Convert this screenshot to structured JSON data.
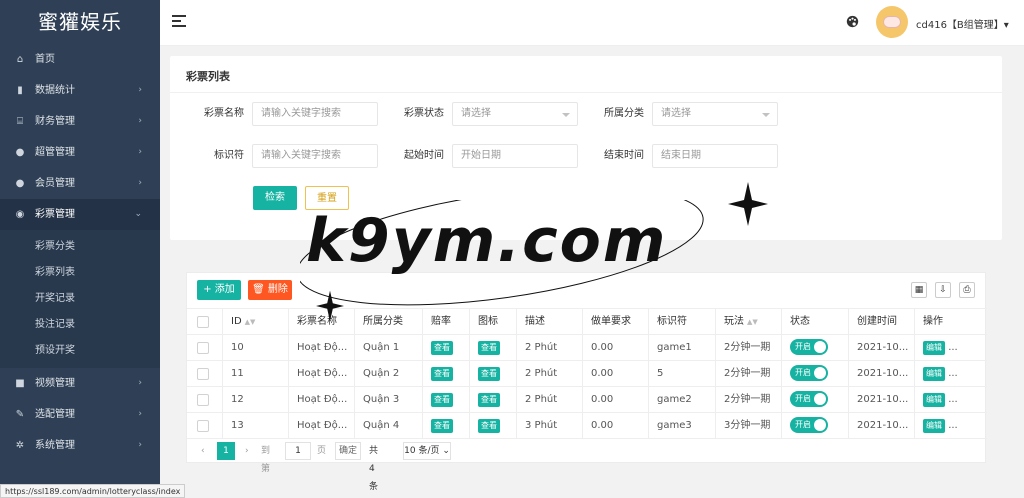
{
  "sidebar": {
    "logo": "蜜獾娱乐",
    "items": [
      {
        "label": "首页",
        "icon": "home-icon",
        "glyph": "⌂",
        "arrow": ""
      },
      {
        "label": "数据统计",
        "icon": "bar-chart-icon",
        "glyph": "▮",
        "arrow": "›"
      },
      {
        "label": "财务管理",
        "icon": "bank-icon",
        "glyph": "⌸",
        "arrow": "›"
      },
      {
        "label": "超管管理",
        "icon": "user-icon",
        "glyph": "●",
        "arrow": "›"
      },
      {
        "label": "会员管理",
        "icon": "users-icon",
        "glyph": "●",
        "arrow": "›"
      },
      {
        "label": "彩票管理",
        "icon": "gamepad-icon",
        "glyph": "◉",
        "arrow": "⌄"
      },
      {
        "label": "视频管理",
        "icon": "video-icon",
        "glyph": "■",
        "arrow": "›"
      },
      {
        "label": "选配管理",
        "icon": "edit-icon",
        "glyph": "✎",
        "arrow": "›"
      },
      {
        "label": "系统管理",
        "icon": "gear-icon",
        "glyph": "✲",
        "arrow": "›"
      }
    ],
    "subitems": [
      "彩票分类",
      "彩票列表",
      "开奖记录",
      "投注记录",
      "预设开奖"
    ]
  },
  "topbar": {
    "username": "cd416【B组管理】▾"
  },
  "form": {
    "title": "彩票列表",
    "labels": {
      "name": "彩票名称",
      "status": "彩票状态",
      "category": "所属分类",
      "code": "标识符",
      "start": "起始时间",
      "end": "结束时间"
    },
    "placeholders": {
      "name": "请输入关键字搜索",
      "status": "请选择",
      "category": "请选择",
      "code": "请输入关键字搜索",
      "start": "开始日期",
      "end": "结束日期"
    },
    "search_label": "检索",
    "reset_label": "重置"
  },
  "table": {
    "add_label": "+ 添加",
    "delete_label": "🗑 删除",
    "headers": [
      "ID",
      "彩票名称",
      "所属分类",
      "赔率",
      "图标",
      "描述",
      "做单要求",
      "标识符",
      "玩法",
      "状态",
      "创建时间",
      "操作"
    ],
    "rows": [
      {
        "id": "10",
        "name": "Hoạt Độ...",
        "category": "Quận 1",
        "odds": "查看",
        "icon": "查看",
        "desc": "2 Phút",
        "req": "0.00",
        "code": "game1",
        "play": "2分钟一期",
        "status": "开启",
        "created": "2021-10...",
        "op": "编辑",
        "more": "..."
      },
      {
        "id": "11",
        "name": "Hoạt Độ...",
        "category": "Quận 2",
        "odds": "查看",
        "icon": "查看",
        "desc": "2 Phút",
        "req": "0.00",
        "code": "5",
        "play": "2分钟一期",
        "status": "开启",
        "created": "2021-10...",
        "op": "编辑",
        "more": "..."
      },
      {
        "id": "12",
        "name": "Hoạt Độ...",
        "category": "Quận 3",
        "odds": "查看",
        "icon": "查看",
        "desc": "2 Phút",
        "req": "0.00",
        "code": "game2",
        "play": "2分钟一期",
        "status": "开启",
        "created": "2021-10...",
        "op": "编辑",
        "more": "..."
      },
      {
        "id": "13",
        "name": "Hoạt Độ...",
        "category": "Quận 4",
        "odds": "查看",
        "icon": "查看",
        "desc": "3 Phút",
        "req": "0.00",
        "code": "game3",
        "play": "3分钟一期",
        "status": "开启",
        "created": "2021-10...",
        "op": "编辑",
        "more": "..."
      }
    ],
    "pagination": {
      "current_page": "1",
      "goto_label": "到第",
      "goto_value": "1",
      "page_suffix": "页",
      "confirm_label": "确定",
      "total": "共 4 条",
      "per_page": "10 条/页 ⌄"
    }
  },
  "status_url": "https://ssl189.com/admin/lotteryclass/index",
  "watermark": "k9ym.com",
  "colors": {
    "accent": "#16b3a2",
    "danger": "#ff5722",
    "sidebar": "#2f4056"
  }
}
